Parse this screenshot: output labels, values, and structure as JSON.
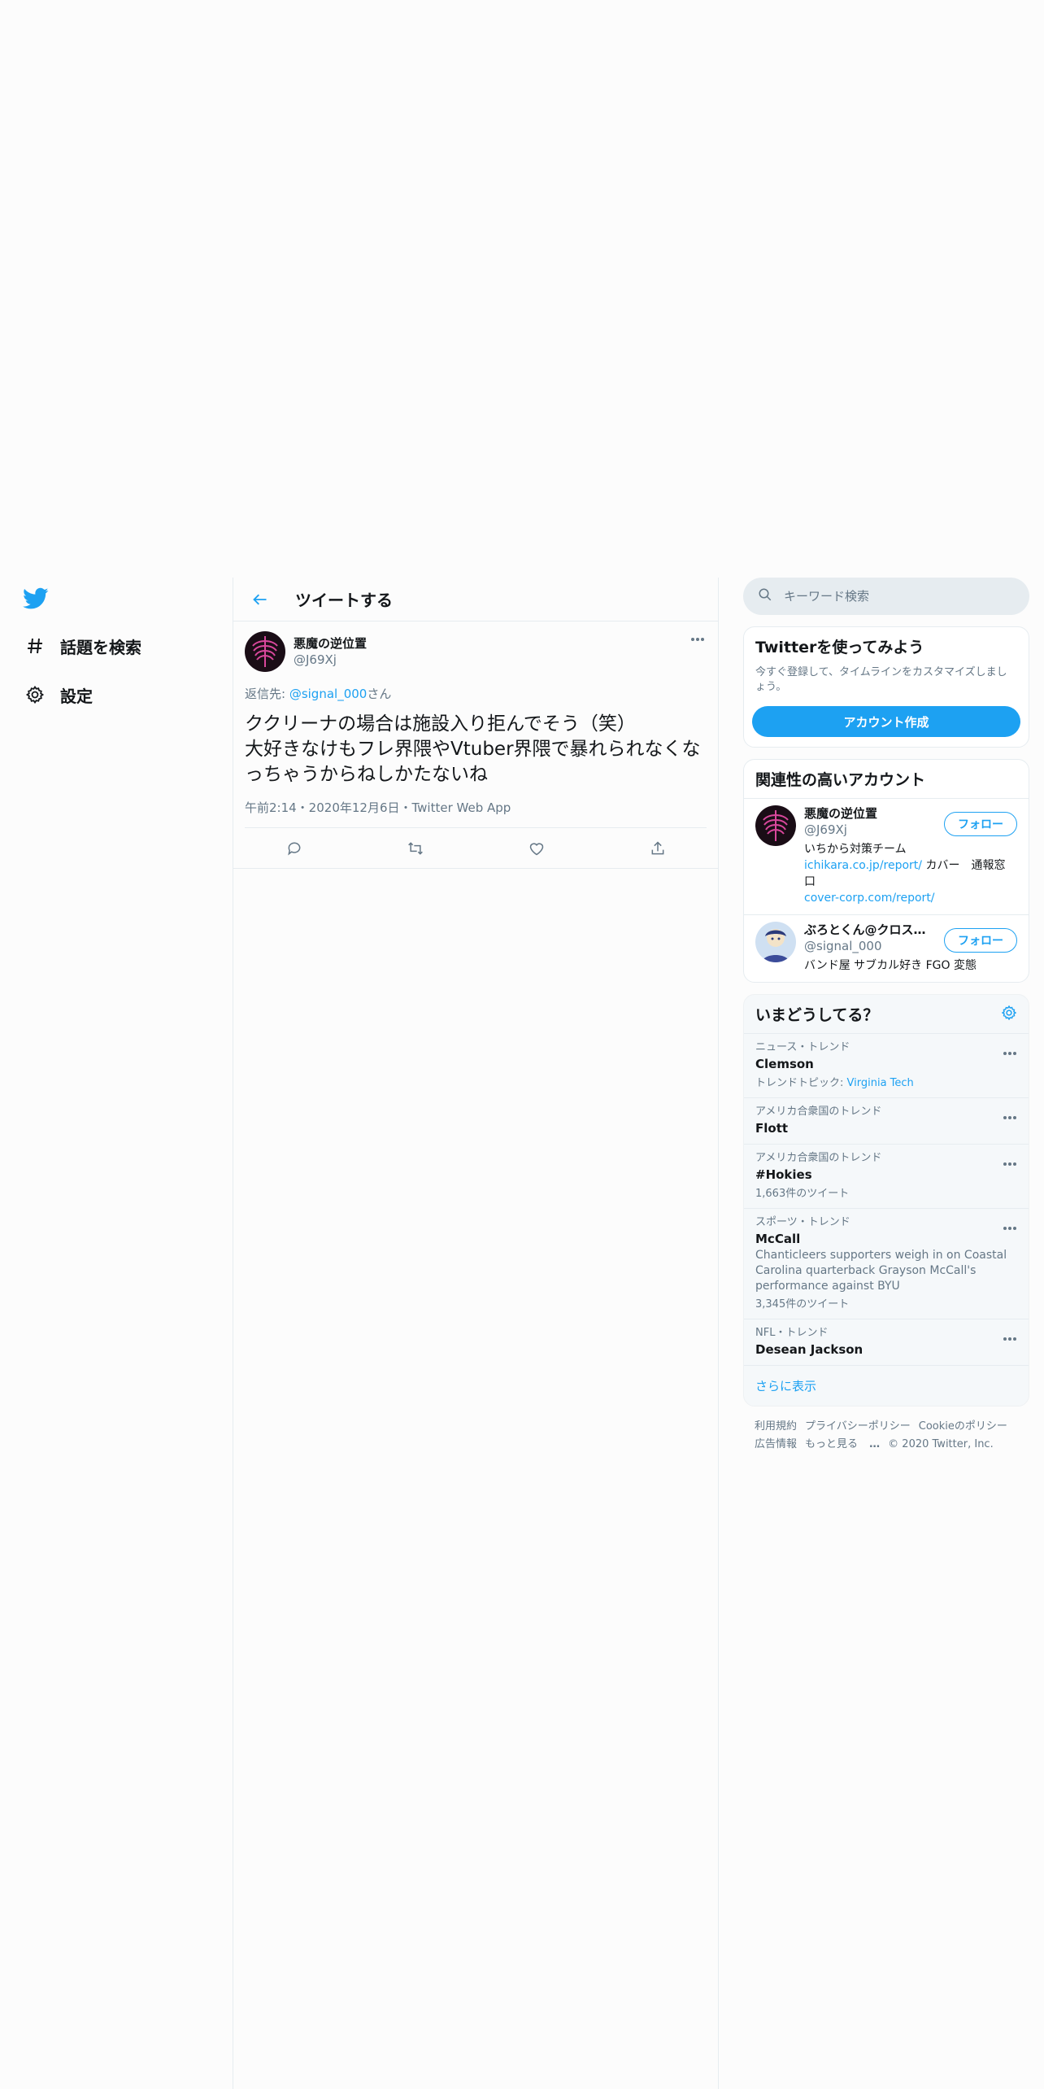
{
  "nav": {
    "items": [
      {
        "label": "話題を検索",
        "icon": "hashtag-icon"
      },
      {
        "label": "設定",
        "icon": "gear-icon"
      }
    ]
  },
  "header": {
    "title": "ツイートする"
  },
  "tweet": {
    "author_name": "悪魔の逆位置",
    "author_handle": "@J69Xj",
    "reply_prefix": "返信先: ",
    "reply_mention": "@signal_000",
    "reply_suffix": "さん",
    "text": "ククリーナの場合は施設入り拒んでそう（笑）\n大好きなけもフレ界隈やVtuber界隈で暴れられなくな\nっちゃうからねしかたないね",
    "meta": "午前2:14・2020年12月6日・Twitter Web App"
  },
  "search": {
    "placeholder": "キーワード検索"
  },
  "signup": {
    "title": "Twitterを使ってみよう",
    "desc": "今すぐ登録して、タイムラインをカスタマイズしましょう。",
    "button": "アカウント作成"
  },
  "related": {
    "title": "関連性の高いアカウント",
    "follow_label": "フォロー",
    "accounts": [
      {
        "name": "悪魔の逆位置",
        "handle": "@J69Xj",
        "bio_line1": "いちから対策チーム",
        "bio_link1": "ichikara.co.jp/report/",
        "bio_mid": " カバー　通報窓口",
        "bio_link2": "cover-corp.com/report/"
      },
      {
        "name": "ぶろとくん@クロス…",
        "handle": "@signal_000",
        "bio": "バンド屋 サブカル好き FGO 変態"
      }
    ]
  },
  "trends": {
    "title": "いまどうしてる？",
    "items": [
      {
        "category": "ニュース・トレンド",
        "name": "Clemson",
        "sub_prefix": "トレンドトピック: ",
        "sub_link": "Virginia Tech"
      },
      {
        "category": "アメリカ合衆国のトレンド",
        "name": "Flott"
      },
      {
        "category": "アメリカ合衆国のトレンド",
        "name": "#Hokies",
        "count": "1,663件のツイート"
      },
      {
        "category": "スポーツ・トレンド",
        "name": "McCall",
        "desc": "Chanticleers supporters weigh in on Coastal Carolina quarterback Grayson McCall's performance against BYU",
        "count": "3,345件のツイート"
      },
      {
        "category": "NFL・トレンド",
        "name": "Desean Jackson"
      }
    ],
    "show_more": "さらに表示"
  },
  "footer": {
    "links": [
      "利用規約",
      "プライバシーポリシー",
      "Cookieのポリシー",
      "広告情報",
      "もっと見る"
    ],
    "copyright": "© 2020 Twitter, Inc."
  }
}
